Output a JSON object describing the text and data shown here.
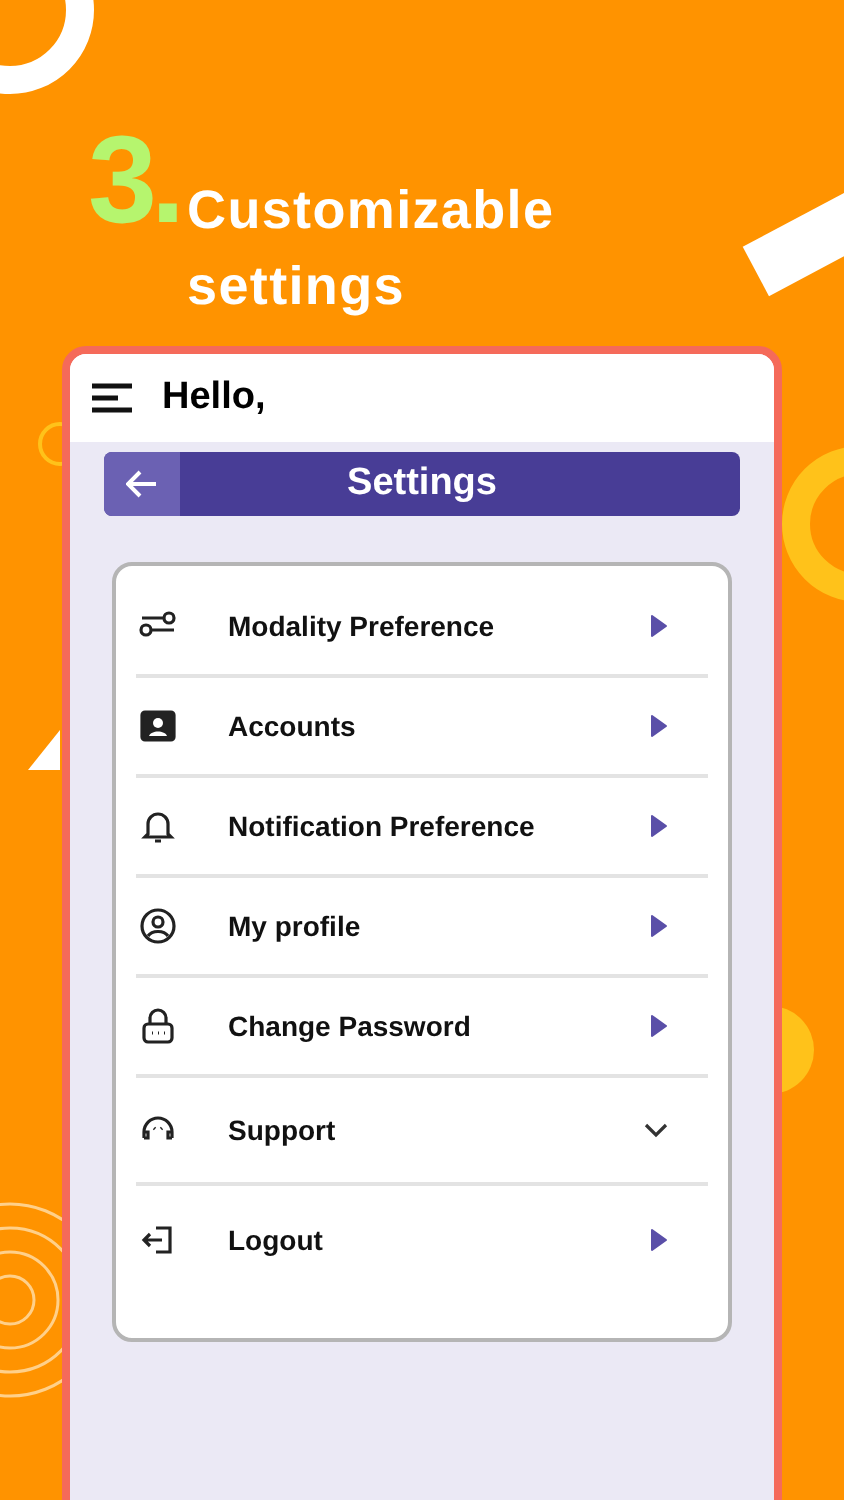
{
  "headline": {
    "number": "3.",
    "title": "Customizable settings"
  },
  "app": {
    "greeting": "Hello,",
    "header_title": "Settings",
    "items": [
      {
        "label": "Modality Preference",
        "kind": "arrow"
      },
      {
        "label": "Accounts",
        "kind": "arrow"
      },
      {
        "label": "Notification Preference",
        "kind": "arrow"
      },
      {
        "label": "My profile",
        "kind": "arrow"
      },
      {
        "label": "Change Password",
        "kind": "arrow"
      },
      {
        "label": "Support",
        "kind": "dropdown"
      },
      {
        "label": "Logout",
        "kind": "arrow"
      }
    ]
  }
}
